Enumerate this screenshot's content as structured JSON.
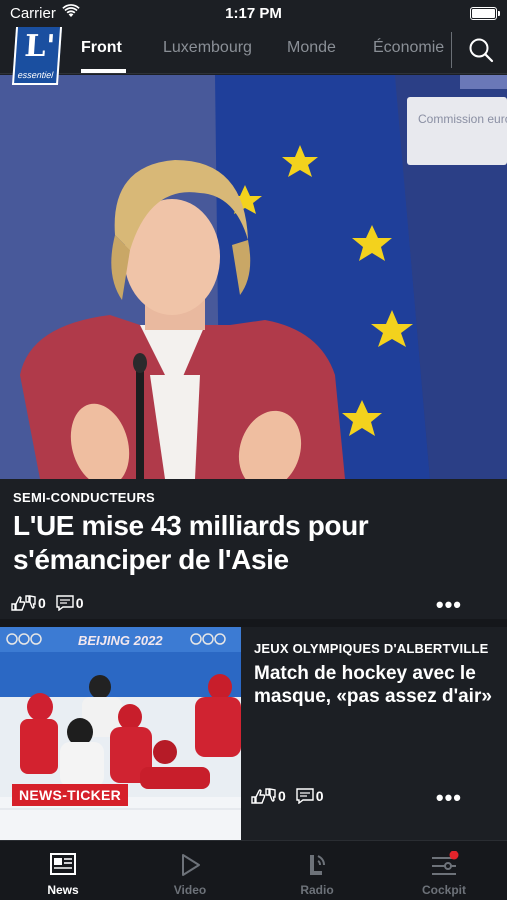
{
  "status": {
    "carrier": "Carrier",
    "time": "1:17 PM"
  },
  "brand": {
    "logo_letter": "L'",
    "logo_sub": "essentiel"
  },
  "nav": {
    "tabs": [
      {
        "label": "Front",
        "active": true
      },
      {
        "label": "Luxembourg",
        "active": false
      },
      {
        "label": "Monde",
        "active": false
      },
      {
        "label": "Économie",
        "active": false
      }
    ]
  },
  "hero": {
    "kicker": "SEMI-CONDUCTEURS",
    "headline": "L'UE mise 43 milliards pour s'émanciper de l'Asie",
    "likes": "0",
    "comments": "0",
    "image_text": "Commission européenne"
  },
  "article": {
    "kicker": "JEUX OLYMPIQUES D'ALBERTVILLE",
    "title": "Match de hockey avec le masque, «pas assez d'air»",
    "badge": "NEWS-TICKER",
    "image_banner": "BEIJING 2022",
    "likes": "0",
    "comments": "0"
  },
  "tabbar": {
    "items": [
      {
        "label": "News",
        "active": true,
        "icon": "news-icon"
      },
      {
        "label": "Video",
        "active": false,
        "icon": "play-icon"
      },
      {
        "label": "Radio",
        "active": false,
        "icon": "radio-icon"
      },
      {
        "label": "Cockpit",
        "active": false,
        "icon": "cockpit-icon",
        "badge_color": "#e3242b"
      }
    ]
  },
  "colors": {
    "background": "#1c1f24",
    "logo_blue": "#1a4fa0",
    "ticker_red": "#d6202a"
  }
}
